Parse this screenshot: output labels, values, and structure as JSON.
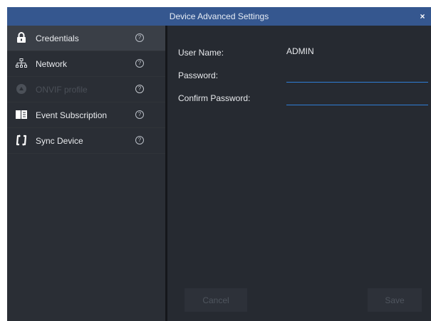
{
  "window": {
    "title": "Device Advanced Settings",
    "close_label": "×"
  },
  "sidebar": {
    "items": [
      {
        "label": "Credentials",
        "icon": "lock-icon",
        "help": "?"
      },
      {
        "label": "Network",
        "icon": "network-icon",
        "help": "?"
      },
      {
        "label": "ONVIF profile",
        "icon": "onvif-icon",
        "help": "?"
      },
      {
        "label": "Event Subscription",
        "icon": "event-icon",
        "help": "?"
      },
      {
        "label": "Sync Device",
        "icon": "sync-icon",
        "help": "?"
      }
    ]
  },
  "form": {
    "username_label": "User Name",
    "username_value": "ADMIN",
    "password_label": "Password",
    "password_value": "",
    "confirm_label": "Confirm Password",
    "confirm_value": "",
    "cancel_label": "Cancel",
    "save_label": "Save"
  },
  "colors": {
    "titlebar": "#35578f",
    "sidebar_bg": "#2a2e35",
    "active_item": "#3a3f47",
    "content_bg": "#262a31",
    "input_underline": "#2f7dd6"
  }
}
